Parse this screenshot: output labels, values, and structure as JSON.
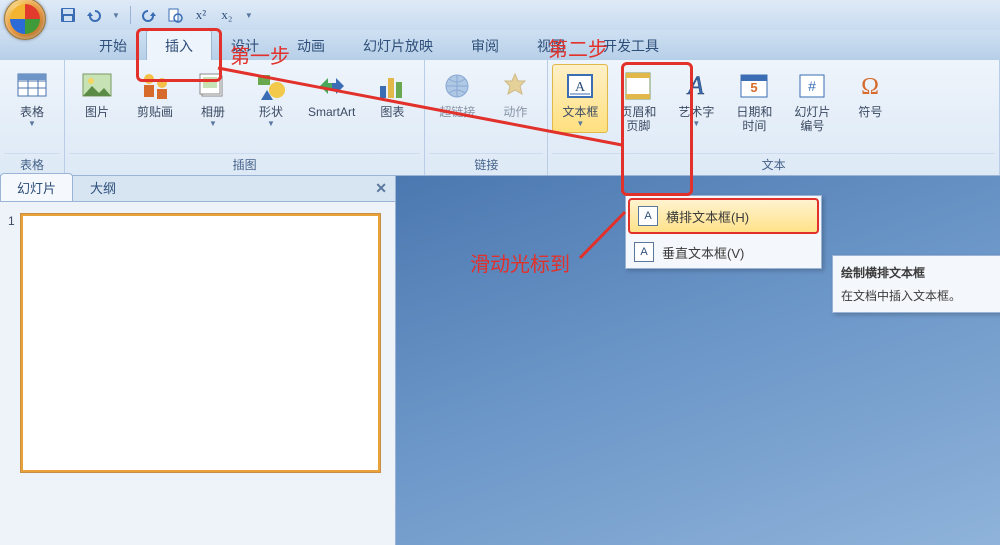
{
  "qat": {
    "save": "保存",
    "undo": "撤销",
    "redo": "重做",
    "print": "打印",
    "super": "x²",
    "sub": "x₂"
  },
  "tabs": {
    "home": "开始",
    "insert": "插入",
    "design": "设计",
    "anim": "动画",
    "slideshow": "幻灯片放映",
    "review": "审阅",
    "view": "视图",
    "dev": "开发工具"
  },
  "ribbon": {
    "table": "表格",
    "picture": "图片",
    "clipart": "剪贴画",
    "album": "相册",
    "shape": "形状",
    "smartart": "SmartArt",
    "chart": "图表",
    "hyperlink": "超链接",
    "action": "动作",
    "textbox": "文本框",
    "headerfooter": "页眉和\n页脚",
    "wordart": "艺术字",
    "datetime": "日期和\n时间",
    "slidenum": "幻灯片\n编号",
    "symbol": "符号",
    "group_tables": "表格",
    "group_illus": "插图",
    "group_links": "链接",
    "group_text": "文本"
  },
  "menu": {
    "horizontal": "横排文本框(H)",
    "vertical": "垂直文本框(V)"
  },
  "tooltip": {
    "title": "绘制横排文本框",
    "body": "在文档中插入文本框。"
  },
  "side": {
    "slides": "幻灯片",
    "outline": "大纲",
    "num1": "1"
  },
  "annotations": {
    "step1": "第一步",
    "step2": "第二步",
    "hint": "滑动光标到"
  }
}
